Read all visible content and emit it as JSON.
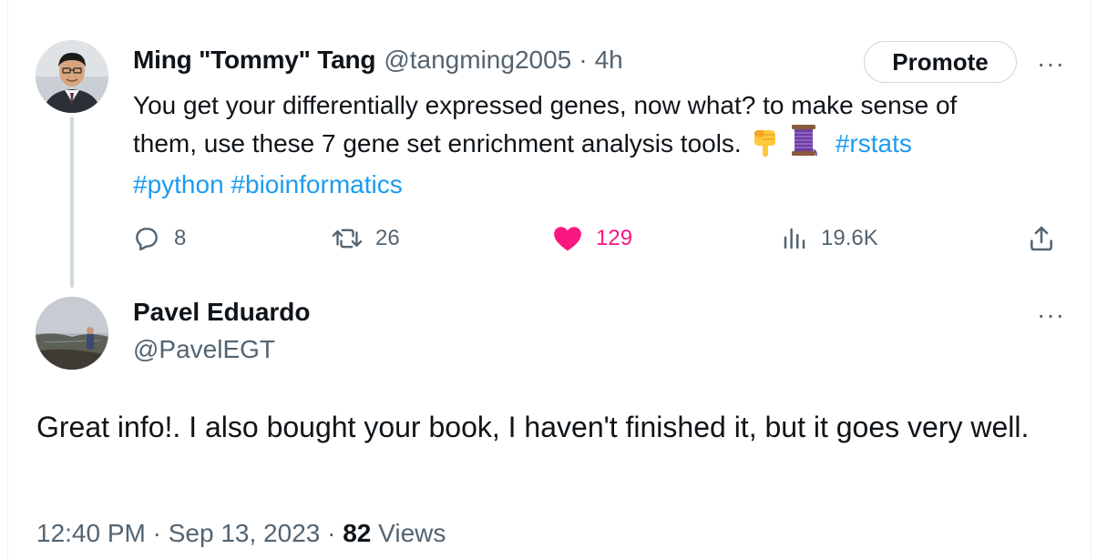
{
  "tweet1": {
    "author_name": "Ming \"Tommy\" Tang",
    "handle": "@tangming2005",
    "separator": "·",
    "time": "4h",
    "promote_label": "Promote",
    "more_label": "···",
    "text_line1": "You get your differentially expressed genes, now what? to make sense of",
    "text_line2": "them, use these 7 gene set enrichment analysis tools.",
    "emoji": [
      "backhand-index-pointing-down",
      "spool-of-thread"
    ],
    "hashtags": [
      "#rstats",
      "#python",
      "#bioinformatics"
    ],
    "actions": {
      "replies": "8",
      "retweets": "26",
      "likes": "129",
      "views": "19.6K"
    }
  },
  "reply": {
    "author_name": "Pavel Eduardo",
    "handle": "@PavelEGT",
    "more_label": "···",
    "text": "Great info!. I also bought your book, I haven't finished it, but it goes very well.",
    "time": "12:40 PM",
    "separator1": "·",
    "date": "Sep 13, 2023",
    "separator2": "·",
    "views_count": "82",
    "views_label": "Views"
  },
  "colors": {
    "link": "#1d9bf0",
    "like": "#f91880",
    "secondary_text": "#536471",
    "thread_line": "#cfd9de"
  }
}
